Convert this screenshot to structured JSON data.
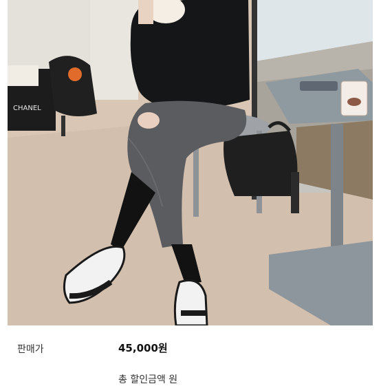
{
  "photo": {
    "bag_brand": "CHANEL"
  },
  "listing": {
    "price_label": "판매가",
    "price_value": "45,000원",
    "discount_partial": "총 할인금액 원"
  }
}
